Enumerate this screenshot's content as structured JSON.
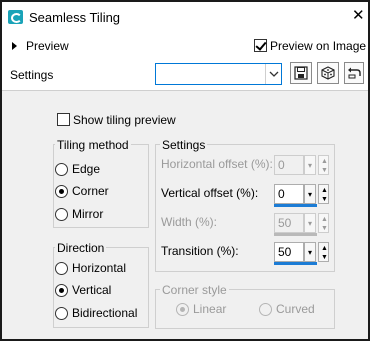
{
  "window": {
    "title": "Seamless Tiling",
    "close_glyph": "✕"
  },
  "preview": {
    "toggle_label": "Preview",
    "preview_on_image_label": "Preview on Image",
    "preview_on_image_checked": true
  },
  "settings_bar": {
    "label": "Settings",
    "preset_value": "",
    "dropdown_glyph": "⌄",
    "save_icon": "save-icon",
    "randomize_icon": "dice-icon",
    "reset_icon": "reset-icon"
  },
  "show_tiling_preview": {
    "label": "Show tiling preview",
    "checked": false
  },
  "tiling_method": {
    "title": "Tiling method",
    "options": [
      {
        "label": "Edge",
        "selected": false
      },
      {
        "label": "Corner",
        "selected": true
      },
      {
        "label": "Mirror",
        "selected": false
      }
    ]
  },
  "direction": {
    "title": "Direction",
    "options": [
      {
        "label": "Horizontal",
        "selected": false
      },
      {
        "label": "Vertical",
        "selected": true
      },
      {
        "label": "Bidirectional",
        "selected": false
      }
    ]
  },
  "settings": {
    "title": "Settings",
    "horizontal_offset": {
      "label": "Horizontal offset (%):",
      "value": "0",
      "enabled": false
    },
    "vertical_offset": {
      "label": "Vertical offset (%):",
      "value": "0",
      "enabled": true
    },
    "width": {
      "label": "Width (%):",
      "value": "50",
      "enabled": false
    },
    "transition": {
      "label": "Transition (%):",
      "value": "50",
      "enabled": true
    }
  },
  "corner_style": {
    "title": "Corner style",
    "options": [
      {
        "label": "Linear",
        "selected": true,
        "enabled": false
      },
      {
        "label": "Curved",
        "selected": false,
        "enabled": false
      }
    ]
  }
}
